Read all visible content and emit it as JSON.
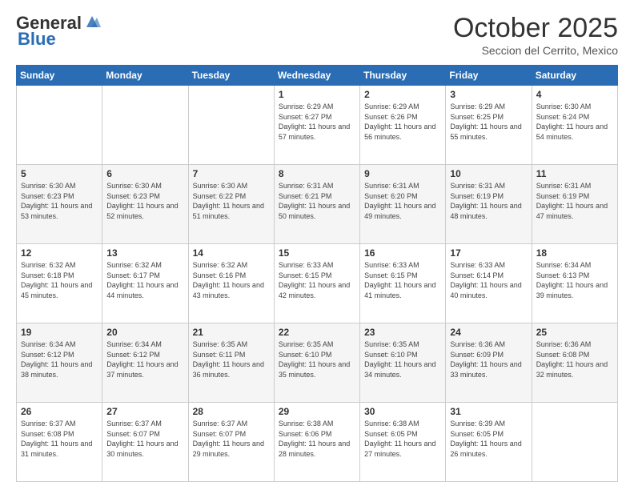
{
  "header": {
    "logo_general": "General",
    "logo_blue": "Blue",
    "month_title": "October 2025",
    "subtitle": "Seccion del Cerrito, Mexico"
  },
  "days_of_week": [
    "Sunday",
    "Monday",
    "Tuesday",
    "Wednesday",
    "Thursday",
    "Friday",
    "Saturday"
  ],
  "weeks": [
    [
      {
        "day": "",
        "info": ""
      },
      {
        "day": "",
        "info": ""
      },
      {
        "day": "",
        "info": ""
      },
      {
        "day": "1",
        "info": "Sunrise: 6:29 AM\nSunset: 6:27 PM\nDaylight: 11 hours and 57 minutes."
      },
      {
        "day": "2",
        "info": "Sunrise: 6:29 AM\nSunset: 6:26 PM\nDaylight: 11 hours and 56 minutes."
      },
      {
        "day": "3",
        "info": "Sunrise: 6:29 AM\nSunset: 6:25 PM\nDaylight: 11 hours and 55 minutes."
      },
      {
        "day": "4",
        "info": "Sunrise: 6:30 AM\nSunset: 6:24 PM\nDaylight: 11 hours and 54 minutes."
      }
    ],
    [
      {
        "day": "5",
        "info": "Sunrise: 6:30 AM\nSunset: 6:23 PM\nDaylight: 11 hours and 53 minutes."
      },
      {
        "day": "6",
        "info": "Sunrise: 6:30 AM\nSunset: 6:23 PM\nDaylight: 11 hours and 52 minutes."
      },
      {
        "day": "7",
        "info": "Sunrise: 6:30 AM\nSunset: 6:22 PM\nDaylight: 11 hours and 51 minutes."
      },
      {
        "day": "8",
        "info": "Sunrise: 6:31 AM\nSunset: 6:21 PM\nDaylight: 11 hours and 50 minutes."
      },
      {
        "day": "9",
        "info": "Sunrise: 6:31 AM\nSunset: 6:20 PM\nDaylight: 11 hours and 49 minutes."
      },
      {
        "day": "10",
        "info": "Sunrise: 6:31 AM\nSunset: 6:19 PM\nDaylight: 11 hours and 48 minutes."
      },
      {
        "day": "11",
        "info": "Sunrise: 6:31 AM\nSunset: 6:19 PM\nDaylight: 11 hours and 47 minutes."
      }
    ],
    [
      {
        "day": "12",
        "info": "Sunrise: 6:32 AM\nSunset: 6:18 PM\nDaylight: 11 hours and 45 minutes."
      },
      {
        "day": "13",
        "info": "Sunrise: 6:32 AM\nSunset: 6:17 PM\nDaylight: 11 hours and 44 minutes."
      },
      {
        "day": "14",
        "info": "Sunrise: 6:32 AM\nSunset: 6:16 PM\nDaylight: 11 hours and 43 minutes."
      },
      {
        "day": "15",
        "info": "Sunrise: 6:33 AM\nSunset: 6:15 PM\nDaylight: 11 hours and 42 minutes."
      },
      {
        "day": "16",
        "info": "Sunrise: 6:33 AM\nSunset: 6:15 PM\nDaylight: 11 hours and 41 minutes."
      },
      {
        "day": "17",
        "info": "Sunrise: 6:33 AM\nSunset: 6:14 PM\nDaylight: 11 hours and 40 minutes."
      },
      {
        "day": "18",
        "info": "Sunrise: 6:34 AM\nSunset: 6:13 PM\nDaylight: 11 hours and 39 minutes."
      }
    ],
    [
      {
        "day": "19",
        "info": "Sunrise: 6:34 AM\nSunset: 6:12 PM\nDaylight: 11 hours and 38 minutes."
      },
      {
        "day": "20",
        "info": "Sunrise: 6:34 AM\nSunset: 6:12 PM\nDaylight: 11 hours and 37 minutes."
      },
      {
        "day": "21",
        "info": "Sunrise: 6:35 AM\nSunset: 6:11 PM\nDaylight: 11 hours and 36 minutes."
      },
      {
        "day": "22",
        "info": "Sunrise: 6:35 AM\nSunset: 6:10 PM\nDaylight: 11 hours and 35 minutes."
      },
      {
        "day": "23",
        "info": "Sunrise: 6:35 AM\nSunset: 6:10 PM\nDaylight: 11 hours and 34 minutes."
      },
      {
        "day": "24",
        "info": "Sunrise: 6:36 AM\nSunset: 6:09 PM\nDaylight: 11 hours and 33 minutes."
      },
      {
        "day": "25",
        "info": "Sunrise: 6:36 AM\nSunset: 6:08 PM\nDaylight: 11 hours and 32 minutes."
      }
    ],
    [
      {
        "day": "26",
        "info": "Sunrise: 6:37 AM\nSunset: 6:08 PM\nDaylight: 11 hours and 31 minutes."
      },
      {
        "day": "27",
        "info": "Sunrise: 6:37 AM\nSunset: 6:07 PM\nDaylight: 11 hours and 30 minutes."
      },
      {
        "day": "28",
        "info": "Sunrise: 6:37 AM\nSunset: 6:07 PM\nDaylight: 11 hours and 29 minutes."
      },
      {
        "day": "29",
        "info": "Sunrise: 6:38 AM\nSunset: 6:06 PM\nDaylight: 11 hours and 28 minutes."
      },
      {
        "day": "30",
        "info": "Sunrise: 6:38 AM\nSunset: 6:05 PM\nDaylight: 11 hours and 27 minutes."
      },
      {
        "day": "31",
        "info": "Sunrise: 6:39 AM\nSunset: 6:05 PM\nDaylight: 11 hours and 26 minutes."
      },
      {
        "day": "",
        "info": ""
      }
    ]
  ]
}
